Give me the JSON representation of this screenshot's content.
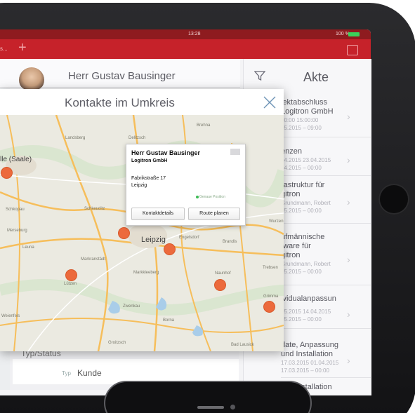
{
  "status_bar": {
    "time": "13:28",
    "battery": "100 %"
  },
  "nav": {
    "crumb": "s..."
  },
  "contact": {
    "name": "Herr Gustav Bausinger"
  },
  "akte": {
    "title": "Akte",
    "items": [
      {
        "line1": "jektabschluss",
        "line2": "Logitron GmbH",
        "line3": "00:00 15:00:00",
        "line4": "05.2015 – 09:00"
      },
      {
        "line1": "enzen",
        "line2": "04.2015 23.04.2015",
        "line3": "04.2015 – 00:00"
      },
      {
        "line1": "rastruktur für",
        "line2": "gitron",
        "line3": "Grundmann, Robert",
        "line4": "05.2015 – 00:00"
      },
      {
        "line1": "ufmännische",
        "line2": "tware für",
        "line3": "gitron",
        "line4": "Grundmann, Robert",
        "line5": "05.2015 – 00:00"
      },
      {
        "line1": "ividualanpassun",
        "line2": "05.2015 14.04.2015",
        "line3": "05.2015 – 00:00"
      },
      {
        "line1": "date, Anpassung",
        "line2": "und Installation",
        "line3": "17.03.2015 01.04.2015",
        "line4": "17.03.2015 – 00:00"
      },
      {
        "line1": "Installation"
      }
    ]
  },
  "background": {
    "typ_label": "Typ/Status",
    "typ_key": "Typ",
    "typ_value": "Kunde"
  },
  "modal": {
    "title": "Kontakte im Umkreis",
    "map_labels": [
      {
        "text": "Landsberg"
      },
      {
        "text": "Delitzsch"
      },
      {
        "text": "Brehna"
      },
      {
        "text": "lle (Saale)"
      },
      {
        "text": "Schkopau"
      },
      {
        "text": "Schkeuditz"
      },
      {
        "text": "Leuna"
      },
      {
        "text": "Merseburg"
      },
      {
        "text": "Markranstädt"
      },
      {
        "text": "Leipzig"
      },
      {
        "text": "Engelsdorf"
      },
      {
        "text": "Brandis"
      },
      {
        "text": "Markkleeberg"
      },
      {
        "text": "Naunhof"
      },
      {
        "text": "Lützen"
      },
      {
        "text": "Zwenkau"
      },
      {
        "text": "Grimma"
      },
      {
        "text": "Weienfels"
      },
      {
        "text": "Borna"
      },
      {
        "text": "Groitzsch"
      },
      {
        "text": "Bad Lausick"
      },
      {
        "text": "Trebsen"
      },
      {
        "text": "Wurzen"
      }
    ],
    "popup": {
      "name": "Herr Gustav Bausinger",
      "company": "Logitron GmbH",
      "street": "Fabrikstraße 17",
      "city": "Leipzig",
      "exact": "Genaue Position",
      "btn_details": "Kontaktdetails",
      "btn_route": "Route planen"
    }
  },
  "colors": {
    "brand_red": "#c6222a",
    "pin": "#ec6a3c"
  }
}
